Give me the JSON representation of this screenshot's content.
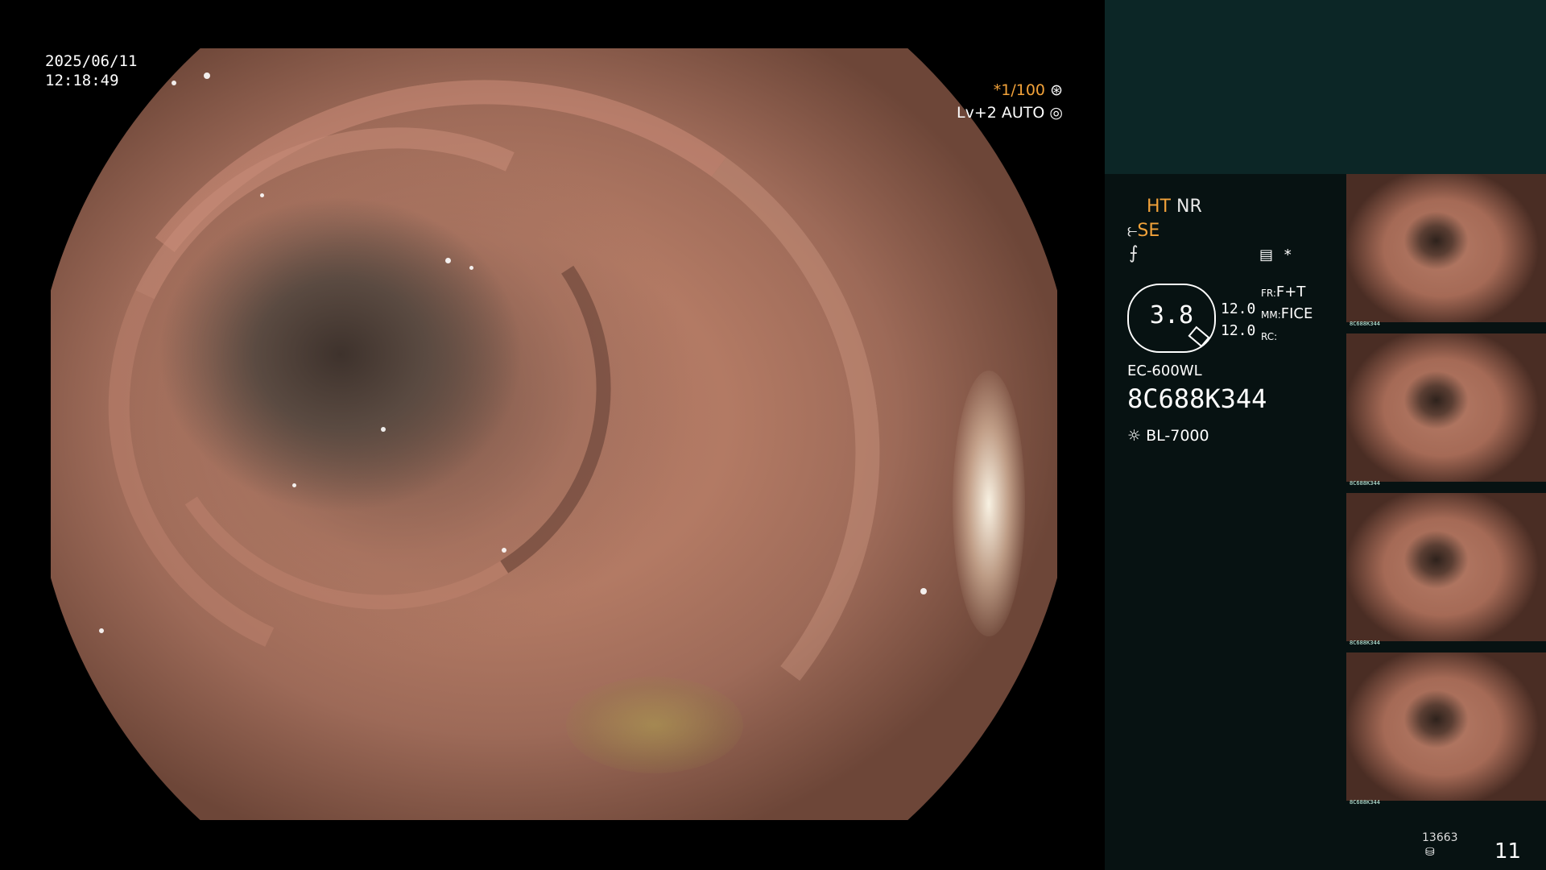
{
  "overlay": {
    "date": "2025/06/11",
    "time": "12:18:49",
    "shutter": "*1/100",
    "level": "Lv+2 AUTO"
  },
  "panel": {
    "ht": "HT",
    "nr": "NR",
    "se": "SE",
    "zoom": "3.8",
    "values": [
      "12.0",
      "12.0"
    ],
    "fr_label": "FR:",
    "fr_value": "F+T",
    "mm_label": "MM:",
    "mm_value": "FICE",
    "rc_label": "RC:",
    "scope_model": "EC-600WL",
    "serial": "8C688K344",
    "light_source": "BL-7000",
    "asterisk": "*"
  },
  "thumbnails": [
    {
      "caption": "8C688K344"
    },
    {
      "caption": "8C688K344"
    },
    {
      "caption": "8C688K344"
    },
    {
      "caption": "8C688K344"
    }
  ],
  "footer": {
    "count": "13663",
    "page": "11"
  },
  "colors": {
    "accent_orange": "#f2a23a",
    "panel_bg": "#071212",
    "panel_top": "#0c2626"
  }
}
